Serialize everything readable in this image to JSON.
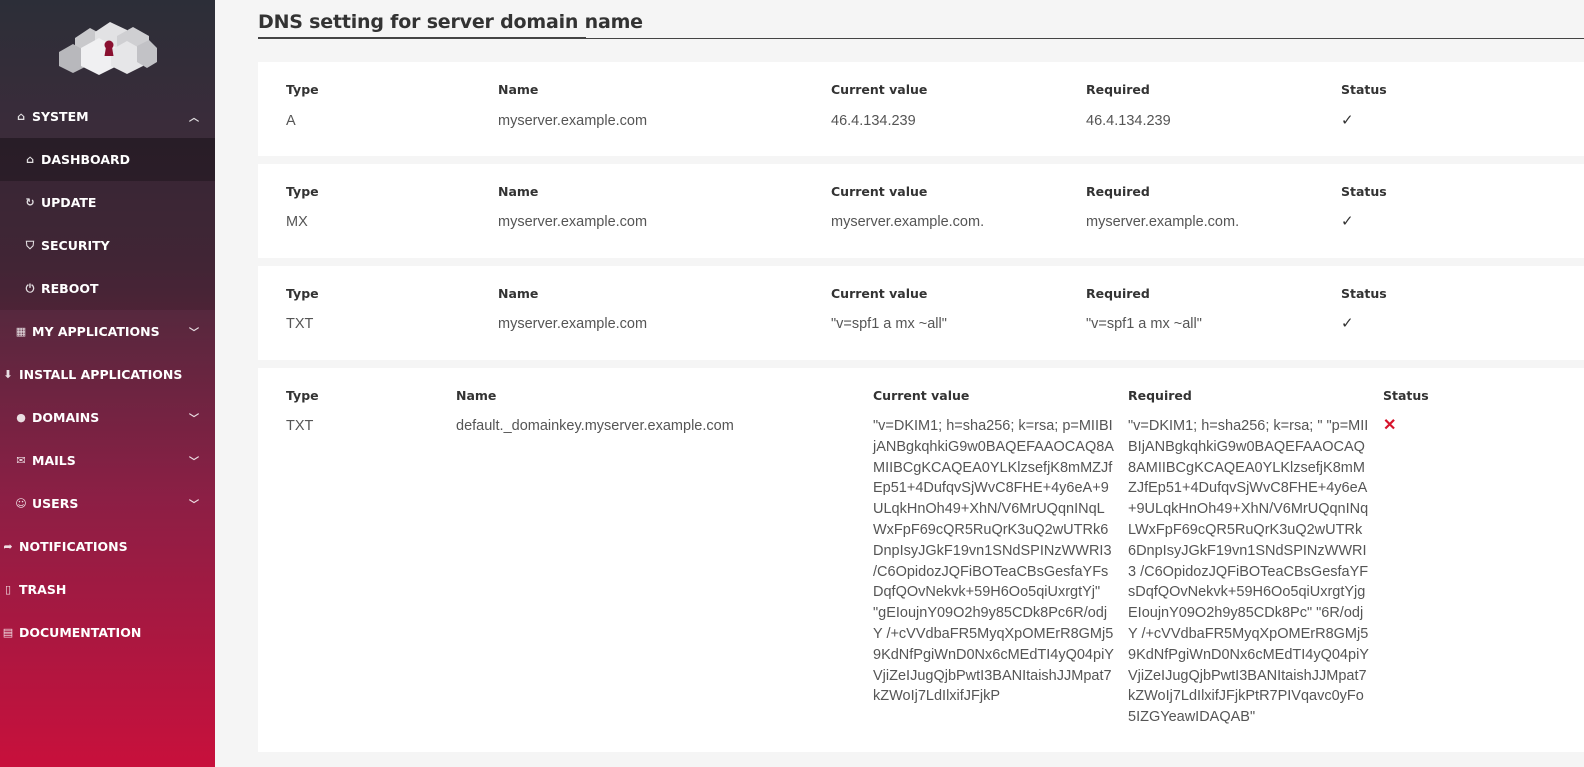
{
  "sidebar": {
    "logo_icon": "cloud-keyhole-logo",
    "items": [
      {
        "label": "SYSTEM",
        "icon": "home-icon",
        "expanded": true
      },
      {
        "label": "DASHBOARD",
        "icon": "home-icon"
      },
      {
        "label": "UPDATE",
        "icon": "refresh-icon"
      },
      {
        "label": "SECURITY",
        "icon": "shield-icon"
      },
      {
        "label": "REBOOT",
        "icon": "power-icon"
      },
      {
        "label": "MY APPLICATIONS",
        "icon": "grid-icon"
      },
      {
        "label": "INSTALL APPLICATIONS",
        "icon": "download-icon"
      },
      {
        "label": "DOMAINS",
        "icon": "globe-icon"
      },
      {
        "label": "MAILS",
        "icon": "envelope-icon"
      },
      {
        "label": "USERS",
        "icon": "users-icon"
      },
      {
        "label": "NOTIFICATIONS",
        "icon": "share-icon"
      },
      {
        "label": "TRASH",
        "icon": "trash-icon"
      },
      {
        "label": "DOCUMENTATION",
        "icon": "book-icon"
      }
    ]
  },
  "page": {
    "title": "DNS setting for server domain name"
  },
  "columns": {
    "type": "Type",
    "name": "Name",
    "current": "Current value",
    "required": "Required",
    "status": "Status"
  },
  "records": [
    {
      "type": "A",
      "name": "myserver.example.com",
      "current": "46.4.134.239",
      "required": "46.4.134.239",
      "status": "✓"
    },
    {
      "type": "MX",
      "name": "myserver.example.com",
      "current": "myserver.example.com.",
      "required": "myserver.example.com.",
      "status": "✓"
    },
    {
      "type": "TXT",
      "name": "myserver.example.com",
      "current": "\"v=spf1 a mx ~all\"",
      "required": "\"v=spf1 a mx ~all\"",
      "status": "✓"
    },
    {
      "type": "TXT",
      "name": "default._domainkey.myserver.example.com",
      "current": "\"v=DKIM1; h=sha256; k=rsa; p=MIIBIjANBgkqhkiG9w0BAQEFAAOCAQ8AMIIBCgKCAQEA0YLKlzsefjK8mMZJfEp51+4DufqvSjWvC8FHE+4y6eA+9ULqkHnOh49+XhN/V6MrUQqnINqLWxFpF69cQR5RuQrK3uQ2wUTRk6DnpIsyJGkF19vn1SNdSPINzWWRI3 /C6OpidozJQFiBOTeaCBsGesfaYFsDqfQOvNekvk+59H6Oo5qiUxrgtYj\" \"gEIoujnY09O2h9y85CDk8Pc6R/odjY /+cVVdbaFR5MyqXpOMErR8GMj59KdNfPgiWnD0Nx6cMEdTI4yQ04piYVjiZeIJugQjbPwtI3BANItaishJJMpat7kZWoIj7LdIlxifJFjkP",
      "required": "\"v=DKIM1; h=sha256; k=rsa; \" \"p=MIIBIjANBgkqhkiG9w0BAQEFAAOCAQ8AMIIBCgKCAQEA0YLKlzsefjK8mMZJfEp51+4DufqvSjWvC8FHE+4y6eA+9ULqkHnOh49+XhN/V6MrUQqnINqLWxFpF69cQR5RuQrK3uQ2wUTRk6DnpIsyJGkF19vn1SNdSPINzWWRI3 /C6OpidozJQFiBOTeaCBsGesfaYFsDqfQOvNekvk+59H6Oo5qiUxrgtYjgEIoujnY09O2h9y85CDk8Pc\" \"6R/odjY /+cVVdbaFR5MyqXpOMErR8GMj59KdNfPgiWnD0Nx6cMEdTI4yQ04piYVjiZeIJugQjbPwtI3BANItaishJJMpat7kZWoIj7LdIlxifJFjkPtR7PIVqavc0yFo5IZGYeawIDAQAB\"",
      "status": "✕"
    }
  ]
}
